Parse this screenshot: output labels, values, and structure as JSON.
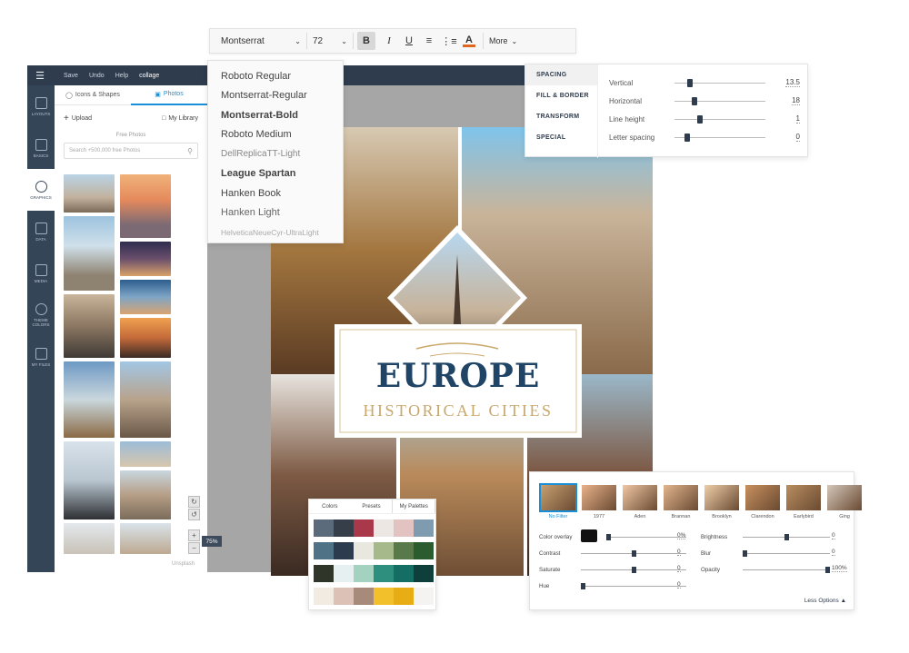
{
  "topbar": {
    "save": "Save",
    "undo": "Undo",
    "help": "Help",
    "doc_name": "collage"
  },
  "rail": [
    {
      "label": "LAYOUTS",
      "icon": "layouts-icon"
    },
    {
      "label": "BASICS",
      "icon": "basics-icon"
    },
    {
      "label": "GRAPHICS",
      "icon": "graphics-icon"
    },
    {
      "label": "DATA",
      "icon": "data-icon"
    },
    {
      "label": "MEDIA",
      "icon": "media-icon"
    },
    {
      "label": "THEME COLORS",
      "icon": "theme-colors-icon"
    },
    {
      "label": "MY FILES",
      "icon": "my-files-icon"
    }
  ],
  "panel": {
    "tab_icons": "Icons & Shapes",
    "tab_photos": "Photos",
    "upload": "Upload",
    "library": "My Library",
    "free_label": "Free Photos",
    "search_placeholder": "Search +500,000 free Photos",
    "credit": "Unsplash"
  },
  "canvas": {
    "title": "EUROPE",
    "subtitle": "HISTORICAL CITIES"
  },
  "zoom": {
    "level": "75%"
  },
  "font_toolbar": {
    "font": "Montserrat",
    "size": "72",
    "bold": "B",
    "italic": "I",
    "underline": "U",
    "color_letter": "A",
    "more": "More"
  },
  "font_options": [
    "Roboto Regular",
    "Montserrat-Regular",
    "Montserrat-Bold",
    "Roboto Medium",
    "DellReplicaTT-Light",
    "League Spartan",
    "Hanken Book",
    "Hanken Light",
    "HelveticaNeueCyr-UltraLight"
  ],
  "spacing": {
    "tabs": [
      "SPACING",
      "FILL & BORDER",
      "TRANSFORM",
      "SPECIAL"
    ],
    "rows": [
      {
        "label": "Vertical",
        "value": "13.5",
        "level": 0.15
      },
      {
        "label": "Horizontal",
        "value": "18",
        "level": 0.2
      },
      {
        "label": "Line height",
        "value": "1",
        "level": 0.27
      },
      {
        "label": "Letter spacing",
        "value": "0",
        "level": 0.12
      }
    ]
  },
  "palette": {
    "tabs": [
      "Colors",
      "Presets",
      "My Palettes"
    ],
    "swatches": [
      [
        "#5c6b7c",
        "#363e4a",
        "#a8384a",
        "#ede7e4",
        "#e2c3c1",
        "#7f9bb0"
      ],
      [
        "#4f7287",
        "#2c3b4e",
        "#e9e8df",
        "#a6b98a",
        "#58794a",
        "#2a5c2f"
      ],
      [
        "#2f3529",
        "#e6f0f0",
        "#a3d3c0",
        "#2f8f7f",
        "#146e63",
        "#0e3f3a"
      ],
      [
        "#f1ebe2",
        "#dcc2b6",
        "#a88a7a",
        "#f2c02a",
        "#e8ac14",
        "#f4f3f2"
      ]
    ]
  },
  "filters": {
    "names": [
      "No Filter",
      "1977",
      "Aden",
      "Brannan",
      "Brooklyn",
      "Clarendon",
      "Earlybird",
      "Ging"
    ],
    "left": [
      {
        "label": "Color overlay",
        "value": "0%",
        "level": 0.0
      },
      {
        "label": "Contrast",
        "value": "0",
        "level": 0.5
      },
      {
        "label": "Saturate",
        "value": "0",
        "level": 0.5
      },
      {
        "label": "Hue",
        "value": "0",
        "level": 0.0
      }
    ],
    "right": [
      {
        "label": "Brightness",
        "value": "0",
        "level": 0.5
      },
      {
        "label": "Blur",
        "value": "0",
        "level": 0.0
      },
      {
        "label": "Opacity",
        "value": "100%",
        "level": 1.0
      }
    ],
    "overlay_color": "#111111",
    "less_options": "Less Options"
  }
}
